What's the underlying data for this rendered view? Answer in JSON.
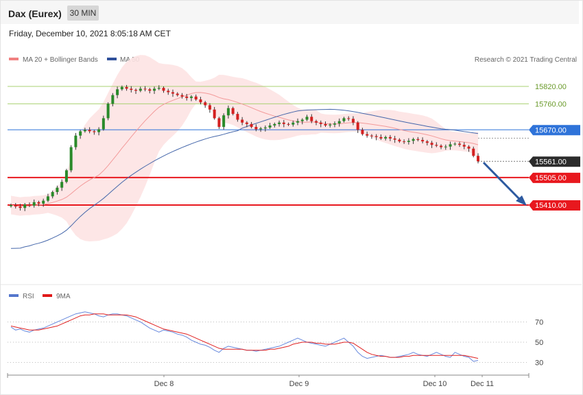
{
  "header": {
    "instrument": "Dax (Eurex)",
    "timeframe": "30 MIN",
    "datetime": "Friday, December 10, 2021 8:05:18 AM CET"
  },
  "legend": {
    "ma20": "MA 20 + Bollinger Bands",
    "ma50": "MA 50",
    "rsi": "RSI",
    "rsi_ma": "9MA"
  },
  "credit": "Research © 2021 Trading Central",
  "colors": {
    "bull": "#2a8a2a",
    "bear": "#d42020",
    "bands": "#fde3e3",
    "ma20": "#f39a9a",
    "ma50": "#4466aa",
    "green_level": "#a8d070",
    "blue_level": "#2f73d9",
    "red_level": "#e8181e",
    "arrow": "#2d5aa0",
    "rsi": "#6688dd",
    "rsi_ma": "#e02020"
  },
  "chart_data": {
    "type": "candlestick",
    "x_labels": [
      "Dec 8",
      "Dec 9",
      "Dec 10",
      "Dec 11"
    ],
    "y_range": [
      15365,
      15880
    ],
    "levels": [
      {
        "value": 15820.0,
        "label": "15820.00",
        "kind": "resistance-minor"
      },
      {
        "value": 15760.0,
        "label": "15760.00",
        "kind": "resistance-minor"
      },
      {
        "value": 15670.0,
        "label": "15670.00",
        "kind": "resistance"
      },
      {
        "value": 15561.0,
        "label": "15561.00",
        "kind": "last-price"
      },
      {
        "value": 15505.0,
        "label": "15505.00",
        "kind": "support"
      },
      {
        "value": 15410.0,
        "label": "15410.00",
        "kind": "support"
      }
    ],
    "close_path": [
      15410,
      15405,
      15400,
      15412,
      15408,
      15420,
      15415,
      15425,
      15440,
      15455,
      15470,
      15490,
      15530,
      15610,
      15650,
      15665,
      15670,
      15665,
      15662,
      15672,
      15710,
      15760,
      15790,
      15810,
      15818,
      15812,
      15808,
      15805,
      15812,
      15810,
      15805,
      15812,
      15815,
      15805,
      15800,
      15795,
      15790,
      15785,
      15780,
      15785,
      15775,
      15765,
      15755,
      15740,
      15710,
      15680,
      15720,
      15745,
      15725,
      15705,
      15695,
      15690,
      15680,
      15672,
      15675,
      15678,
      15685,
      15690,
      15695,
      15690,
      15688,
      15695,
      15700,
      15705,
      15715,
      15700,
      15695,
      15690,
      15685,
      15688,
      15692,
      15700,
      15710,
      15708,
      15695,
      15670,
      15655,
      15650,
      15648,
      15645,
      15640,
      15645,
      15640,
      15636,
      15630,
      15628,
      15632,
      15638,
      15635,
      15630,
      15625,
      15618,
      15615,
      15610,
      15612,
      15620,
      15622,
      15618,
      15612,
      15605,
      15580,
      15561
    ],
    "rsi_axis": [
      30,
      50,
      70
    ],
    "rsi_range": [
      20,
      80
    ],
    "rsi_values": [
      65,
      62,
      63,
      61,
      60,
      62,
      63,
      64,
      66,
      68,
      70,
      72,
      74,
      76,
      78,
      79,
      80,
      79,
      78,
      76,
      75,
      77,
      78,
      78,
      77,
      76,
      74,
      72,
      70,
      67,
      64,
      62,
      60,
      62,
      61,
      60,
      58,
      57,
      55,
      52,
      50,
      48,
      47,
      45,
      42,
      40,
      44,
      46,
      45,
      44,
      43,
      42,
      42,
      41,
      42,
      43,
      44,
      45,
      46,
      48,
      50,
      52,
      54,
      52,
      50,
      49,
      48,
      47,
      46,
      48,
      50,
      52,
      54,
      50,
      46,
      40,
      36,
      34,
      35,
      36,
      37,
      36,
      35,
      35,
      36,
      37,
      38,
      40,
      38,
      37,
      36,
      38,
      40,
      38,
      36,
      35,
      40,
      38,
      36,
      35,
      31,
      32
    ],
    "rsi_ma_values": [
      66,
      65,
      64,
      63,
      62,
      62,
      62,
      63,
      64,
      65,
      66,
      68,
      70,
      72,
      74,
      76,
      77,
      77,
      78,
      78,
      78,
      77,
      77,
      77,
      77,
      77,
      76,
      75,
      73,
      71,
      69,
      67,
      65,
      63,
      62,
      61,
      60,
      59,
      58,
      56,
      54,
      52,
      50,
      48,
      46,
      44,
      43,
      43,
      43,
      43,
      43,
      42,
      42,
      42,
      42,
      42,
      43,
      43,
      44,
      45,
      46,
      48,
      49,
      50,
      50,
      50,
      49,
      49,
      48,
      48,
      48,
      49,
      50,
      50,
      49,
      46,
      43,
      40,
      38,
      37,
      36,
      36,
      35,
      35,
      35,
      36,
      36,
      37,
      37,
      37,
      37,
      37,
      37,
      37,
      37,
      37,
      37,
      37,
      37,
      36,
      35,
      34
    ]
  }
}
